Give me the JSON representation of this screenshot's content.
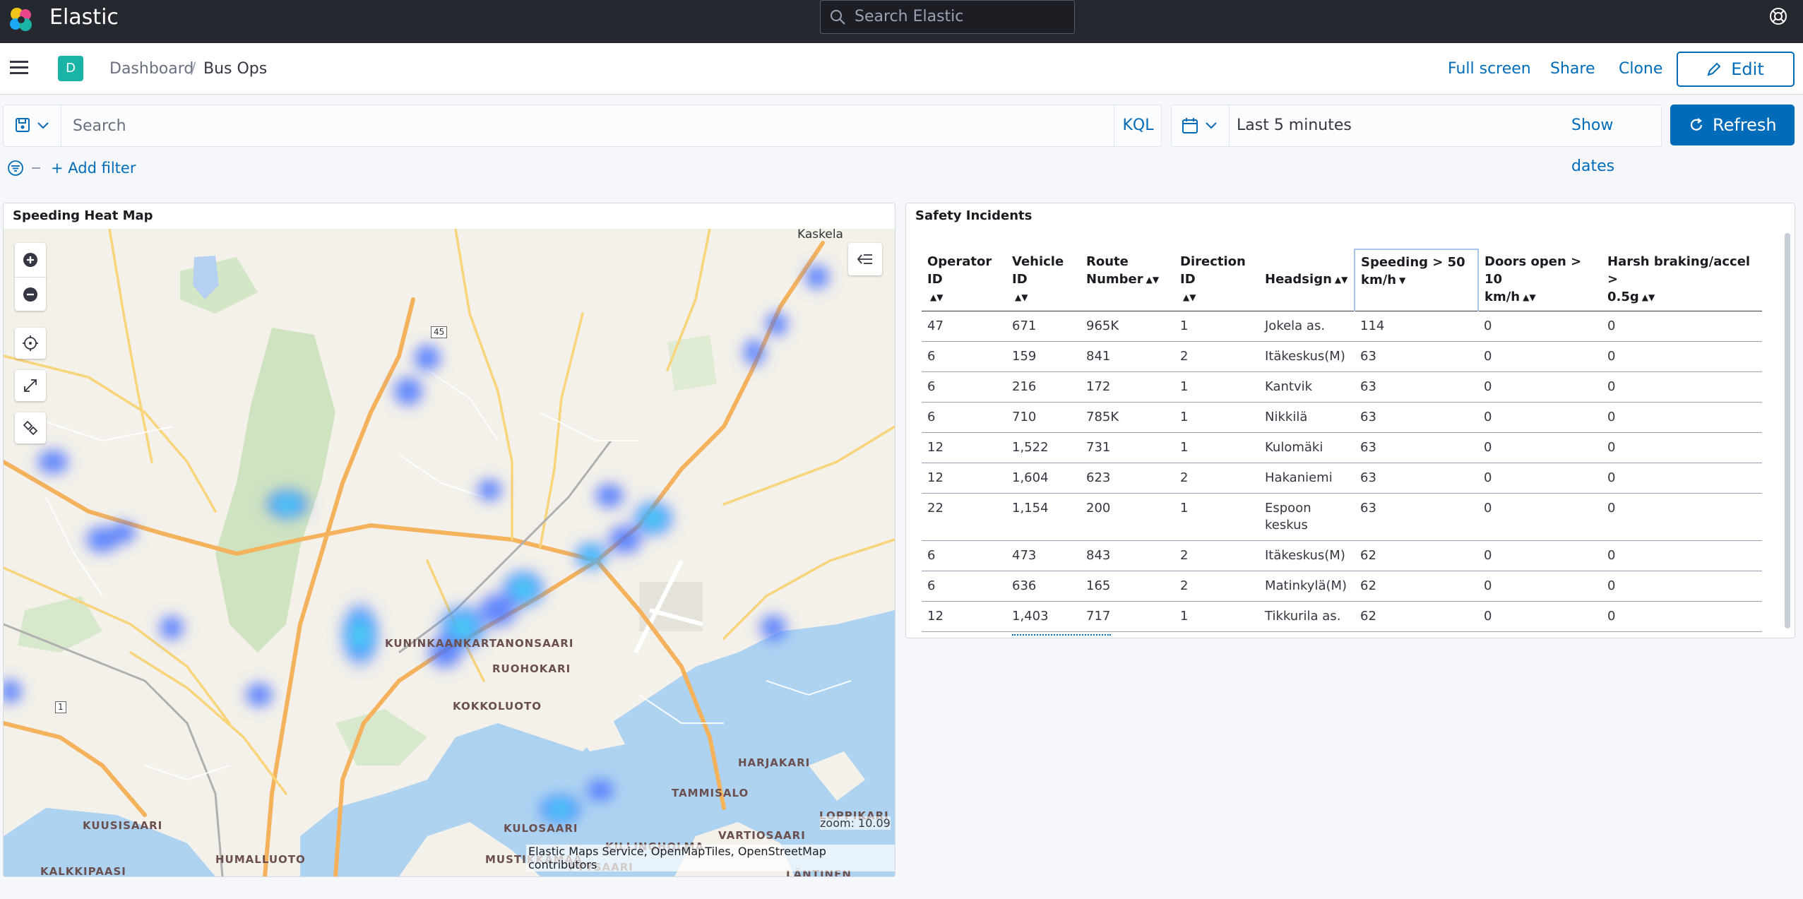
{
  "header": {
    "brand": "Elastic",
    "search_placeholder": "Search Elastic"
  },
  "breadcrumbs": {
    "space_initial": "D",
    "items": [
      "Dashboard",
      "Bus Ops"
    ],
    "separator": "/"
  },
  "top_actions": {
    "full_screen": "Full screen",
    "share": "Share",
    "clone": "Clone",
    "edit": "Edit"
  },
  "query_bar": {
    "placeholder": "Search",
    "language": "KQL",
    "time_range": "Last 5 minutes",
    "show_dates": "Show dates",
    "refresh": "Refresh"
  },
  "filters": {
    "add_filter": "+ Add filter"
  },
  "map_panel": {
    "title": "Speeding Heat Map",
    "zoom_label": "zoom: 10.09",
    "attribution": "Elastic Maps Service, OpenMapTiles, OpenStreetMap contributors",
    "places": [
      "Kaskela",
      "KUNINKAANKARTANONSAARI",
      "RUOHOKARI",
      "KOKKOLUOTO",
      "HARJAKARI",
      "TAMMISALO",
      "VARTIOSAARI",
      "KUUSISAARI",
      "KULOSAARI",
      "HUMALLUOTO",
      "MUSTIKKAMAA",
      "KILLINGHOLMA",
      "PYYSAARI",
      "KALKKIPAASI",
      "LOPPIKARI",
      "LÄNTINEN"
    ],
    "road_shields": [
      "45",
      "1"
    ]
  },
  "table_panel": {
    "title": "Safety Incidents",
    "columns": [
      "Operator ID",
      "Vehicle ID",
      "Route Number",
      "Direction ID",
      "Headsign",
      "Speeding > 50 km/h",
      "Doors open > 10 km/h",
      "Harsh braking/accel > 0.5g"
    ],
    "sorted_column": "Speeding > 50 km/h",
    "rows": [
      [
        "47",
        "671",
        "965K",
        "1",
        "Jokela as.",
        "114",
        "0",
        "0"
      ],
      [
        "6",
        "159",
        "841",
        "2",
        "Itäkeskus(M)",
        "63",
        "0",
        "0"
      ],
      [
        "6",
        "216",
        "172",
        "1",
        "Kantvik",
        "63",
        "0",
        "0"
      ],
      [
        "6",
        "710",
        "785K",
        "1",
        "Nikkilä",
        "63",
        "0",
        "0"
      ],
      [
        "12",
        "1,522",
        "731",
        "1",
        "Kulomäki",
        "63",
        "0",
        "0"
      ],
      [
        "12",
        "1,604",
        "623",
        "2",
        "Hakaniemi",
        "63",
        "0",
        "0"
      ],
      [
        "22",
        "1,154",
        "200",
        "1",
        "Espoon keskus",
        "63",
        "0",
        "0"
      ],
      [
        "6",
        "473",
        "843",
        "2",
        "Itäkeskus(M)",
        "62",
        "0",
        "0"
      ],
      [
        "6",
        "636",
        "165",
        "2",
        "Matinkylä(M)",
        "62",
        "0",
        "0"
      ],
      [
        "12",
        "1,403",
        "717",
        "1",
        "Tikkurila as.",
        "62",
        "0",
        "0"
      ]
    ]
  },
  "colors": {
    "header_bg": "#25282f",
    "accent": "#006bb8",
    "heat": "#3d7bff",
    "heat_hot": "#35e0d8"
  }
}
